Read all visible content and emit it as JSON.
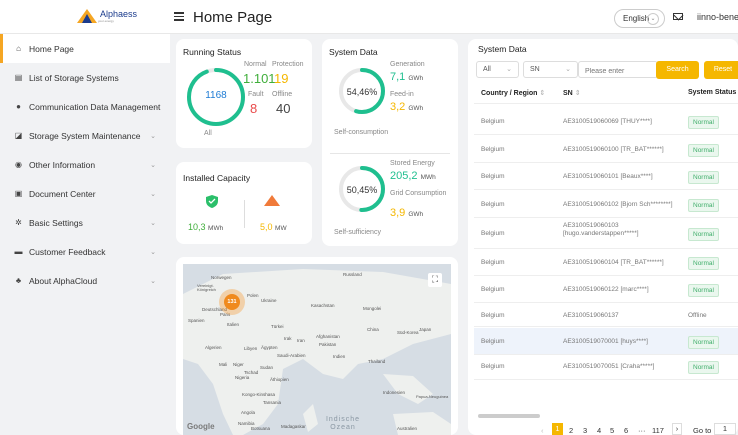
{
  "header": {
    "logo_text": "Alphaess",
    "logo_sub": "your energy",
    "title": "Home Page",
    "language": "English",
    "username": "iinno-benelux"
  },
  "sidebar": {
    "items": [
      {
        "label": "Home Page",
        "icon": "home-icon"
      },
      {
        "label": "List of Storage Systems",
        "icon": "list-icon"
      },
      {
        "label": "Communication Data Management",
        "icon": "user-icon"
      },
      {
        "label": "Storage System Maintenance",
        "icon": "wrench-icon"
      },
      {
        "label": "Other Information",
        "icon": "info-icon"
      },
      {
        "label": "Document Center",
        "icon": "document-icon"
      },
      {
        "label": "Basic Settings",
        "icon": "gear-icon"
      },
      {
        "label": "Customer Feedback",
        "icon": "feedback-icon"
      },
      {
        "label": "About AlphaCloud",
        "icon": "about-icon"
      }
    ]
  },
  "running_status": {
    "title": "Running Status",
    "total": "1168",
    "all_label": "All",
    "normal_label": "Normal",
    "normal_value": "1.101",
    "protection_label": "Protection",
    "protection_value": "19",
    "fault_label": "Fault",
    "fault_value": "8",
    "offline_label": "Offline",
    "offline_value": "40",
    "normal_fraction": 0.943
  },
  "installed_capacity": {
    "title": "Installed Capacity",
    "battery_value": "10,3",
    "battery_unit": "MWh",
    "pv_value": "5,0",
    "pv_unit": "MW"
  },
  "system_data_mini": {
    "title": "System Data",
    "self_consumption_pct": "54,46%",
    "self_consumption_fraction": 0.5446,
    "generation_label": "Generation",
    "generation_value": "7,1",
    "generation_unit": "GWh",
    "feed_in_label": "Feed-in",
    "feed_in_value": "3,2",
    "feed_in_unit": "GWh",
    "self_consumption_label": "Self-consumption",
    "self_sufficiency_pct": "50,45%",
    "self_sufficiency_fraction": 0.5045,
    "stored_label": "Stored Energy",
    "stored_value": "205,2",
    "stored_unit": "MWh",
    "grid_label": "Grid Consumption",
    "grid_value": "3,9",
    "grid_unit": "GWh",
    "self_sufficiency_label": "Self-sufficiency"
  },
  "map": {
    "cluster_count": "131",
    "google": "Google",
    "labels": {
      "norwegen": "Norwegen",
      "vereinigt": "Vereinigt. Königreich",
      "polen": "Polen",
      "deutschland": "Deutschland",
      "paris": "Paris",
      "spanien": "Spanien",
      "italien": "Italien",
      "ukraine": "Ukraine",
      "russland": "Russland",
      "kasachstan": "Kasachstan",
      "mongolei": "Mongolei",
      "turkei": "Türkei",
      "irak": "Irak",
      "iran": "Iran",
      "afghanistan": "Afghanistan",
      "pakistan": "Pakistan",
      "china": "China",
      "suedkorea": "Süd-Korea",
      "japan": "Japan",
      "indien": "Indien",
      "thailand": "Thailand",
      "algerien": "Algerien",
      "libyen": "Libyen",
      "aegypten": "Ägypten",
      "saudi": "Saudi-Arabien",
      "mali": "Mali",
      "niger": "Niger",
      "tschad": "Tschad",
      "sudan": "Sudan",
      "nigeria": "Nigeria",
      "aethiopien": "Äthiopien",
      "kongo": "Kongo-Kinshasa",
      "tansania": "Tansania",
      "angola": "Angola",
      "namibia": "Namibia",
      "botsuana": "Botsuana",
      "madagaskar": "Madagaskar",
      "indonesien": "Indonesien",
      "papua": "Papua-Neuguinea",
      "australien": "Australien",
      "ozean": "Indische Ozean"
    }
  },
  "system_table": {
    "title": "System Data",
    "filter_all": "All",
    "filter_sn": "SN",
    "placeholder": "Please enter",
    "search_label": "Search",
    "reset_label": "Reset",
    "columns": [
      "Country / Region",
      "SN",
      "System Status"
    ],
    "rows": [
      {
        "country": "Belgium",
        "sn": "AE3100519060069 [THUY****]",
        "status": "Normal"
      },
      {
        "country": "Belgium",
        "sn": "AE3100519060100 [TR_BAT******]",
        "status": "Normal"
      },
      {
        "country": "Belgium",
        "sn": "AE3100519060101 [Beaux****]",
        "status": "Normal"
      },
      {
        "country": "Belgium",
        "sn": "AE3100519060102 [Bjorn Sch********]",
        "status": "Normal"
      },
      {
        "country": "Belgium",
        "sn": "AE3100519060103 [hugo.vanderstappen*****]",
        "status": "Normal"
      },
      {
        "country": "Belgium",
        "sn": "AE3100519060104 [TR_BAT******]",
        "status": "Normal"
      },
      {
        "country": "Belgium",
        "sn": "AE3100519060122 [marc****]",
        "status": "Normal"
      },
      {
        "country": "Belgium",
        "sn": "AE3100519060137",
        "status": "Offline"
      },
      {
        "country": "Belgium",
        "sn": "AE3100519070001 [huys****]",
        "status": "Normal"
      },
      {
        "country": "Belgium",
        "sn": "AE3100519070051 [Craha*****]",
        "status": "Normal"
      }
    ],
    "pages": [
      "1",
      "2",
      "3",
      "4",
      "5",
      "6",
      "···",
      "117"
    ],
    "goto_label": "Go to",
    "goto_value": "1"
  }
}
